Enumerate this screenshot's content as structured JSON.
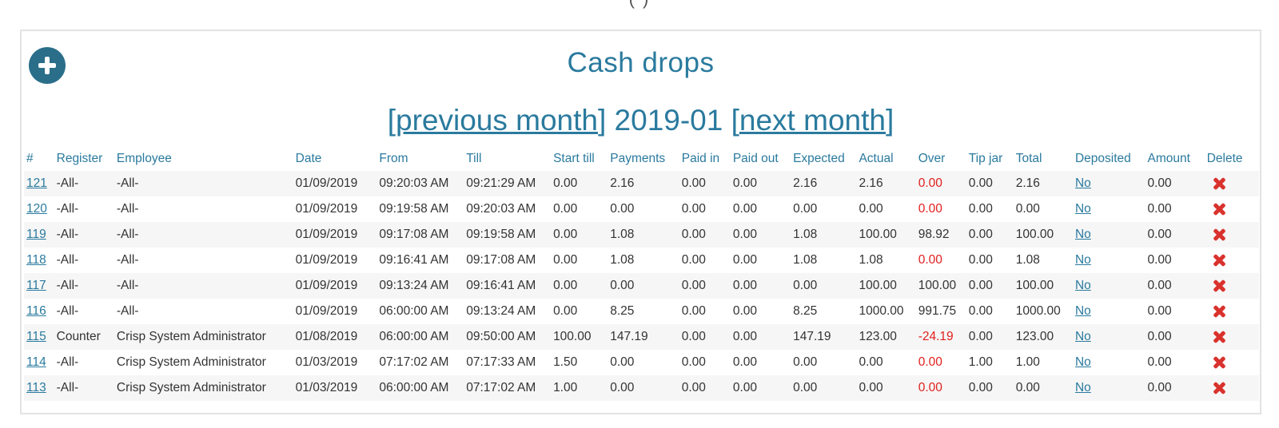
{
  "top_fragment": "( )",
  "colors": {
    "accent": "#2a7a9e",
    "negative": "#e0201e",
    "delete": "#d9322d",
    "stripe": "#f6f6f6"
  },
  "page": {
    "title": "Cash drops",
    "nav": {
      "prev_label": "previous month",
      "month": "2019-01",
      "next_label": "next month"
    }
  },
  "table": {
    "headers": [
      "#",
      "Register",
      "Employee",
      "Date",
      "From",
      "Till",
      "Start till",
      "Payments",
      "Paid in",
      "Paid out",
      "Expected",
      "Actual",
      "Over",
      "Tip jar",
      "Total",
      "Deposited",
      "Amount",
      "Delete"
    ],
    "rows": [
      {
        "id": "121",
        "register": "-All-",
        "employee": "-All-",
        "date": "01/09/2019",
        "from": "09:20:03 AM",
        "till": "09:21:29 AM",
        "start_till": "0.00",
        "payments": "2.16",
        "paid_in": "0.00",
        "paid_out": "0.00",
        "expected": "2.16",
        "actual": "2.16",
        "over": "0.00",
        "over_negative": true,
        "tip_jar": "0.00",
        "total": "2.16",
        "deposited": "No",
        "amount": "0.00"
      },
      {
        "id": "120",
        "register": "-All-",
        "employee": "-All-",
        "date": "01/09/2019",
        "from": "09:19:58 AM",
        "till": "09:20:03 AM",
        "start_till": "0.00",
        "payments": "0.00",
        "paid_in": "0.00",
        "paid_out": "0.00",
        "expected": "0.00",
        "actual": "0.00",
        "over": "0.00",
        "over_negative": true,
        "tip_jar": "0.00",
        "total": "0.00",
        "deposited": "No",
        "amount": "0.00"
      },
      {
        "id": "119",
        "register": "-All-",
        "employee": "-All-",
        "date": "01/09/2019",
        "from": "09:17:08 AM",
        "till": "09:19:58 AM",
        "start_till": "0.00",
        "payments": "1.08",
        "paid_in": "0.00",
        "paid_out": "0.00",
        "expected": "1.08",
        "actual": "100.00",
        "over": "98.92",
        "over_negative": false,
        "tip_jar": "0.00",
        "total": "100.00",
        "deposited": "No",
        "amount": "0.00"
      },
      {
        "id": "118",
        "register": "-All-",
        "employee": "-All-",
        "date": "01/09/2019",
        "from": "09:16:41 AM",
        "till": "09:17:08 AM",
        "start_till": "0.00",
        "payments": "1.08",
        "paid_in": "0.00",
        "paid_out": "0.00",
        "expected": "1.08",
        "actual": "1.08",
        "over": "0.00",
        "over_negative": true,
        "tip_jar": "0.00",
        "total": "1.08",
        "deposited": "No",
        "amount": "0.00"
      },
      {
        "id": "117",
        "register": "-All-",
        "employee": "-All-",
        "date": "01/09/2019",
        "from": "09:13:24 AM",
        "till": "09:16:41 AM",
        "start_till": "0.00",
        "payments": "0.00",
        "paid_in": "0.00",
        "paid_out": "0.00",
        "expected": "0.00",
        "actual": "100.00",
        "over": "100.00",
        "over_negative": false,
        "tip_jar": "0.00",
        "total": "100.00",
        "deposited": "No",
        "amount": "0.00"
      },
      {
        "id": "116",
        "register": "-All-",
        "employee": "-All-",
        "date": "01/09/2019",
        "from": "06:00:00 AM",
        "till": "09:13:24 AM",
        "start_till": "0.00",
        "payments": "8.25",
        "paid_in": "0.00",
        "paid_out": "0.00",
        "expected": "8.25",
        "actual": "1000.00",
        "over": "991.75",
        "over_negative": false,
        "tip_jar": "0.00",
        "total": "1000.00",
        "deposited": "No",
        "amount": "0.00"
      },
      {
        "id": "115",
        "register": "Counter",
        "employee": "Crisp System Administrator",
        "date": "01/08/2019",
        "from": "06:00:00 AM",
        "till": "09:50:00 AM",
        "start_till": "100.00",
        "payments": "147.19",
        "paid_in": "0.00",
        "paid_out": "0.00",
        "expected": "147.19",
        "actual": "123.00",
        "over": "-24.19",
        "over_negative": true,
        "tip_jar": "0.00",
        "total": "123.00",
        "deposited": "No",
        "amount": "0.00"
      },
      {
        "id": "114",
        "register": "-All-",
        "employee": "Crisp System Administrator",
        "date": "01/03/2019",
        "from": "07:17:02 AM",
        "till": "07:17:33 AM",
        "start_till": "1.50",
        "payments": "0.00",
        "paid_in": "0.00",
        "paid_out": "0.00",
        "expected": "0.00",
        "actual": "0.00",
        "over": "0.00",
        "over_negative": true,
        "tip_jar": "1.00",
        "total": "1.00",
        "deposited": "No",
        "amount": "0.00"
      },
      {
        "id": "113",
        "register": "-All-",
        "employee": "Crisp System Administrator",
        "date": "01/03/2019",
        "from": "06:00:00 AM",
        "till": "07:17:02 AM",
        "start_till": "1.00",
        "payments": "0.00",
        "paid_in": "0.00",
        "paid_out": "0.00",
        "expected": "0.00",
        "actual": "0.00",
        "over": "0.00",
        "over_negative": true,
        "tip_jar": "0.00",
        "total": "0.00",
        "deposited": "No",
        "amount": "0.00"
      }
    ]
  }
}
